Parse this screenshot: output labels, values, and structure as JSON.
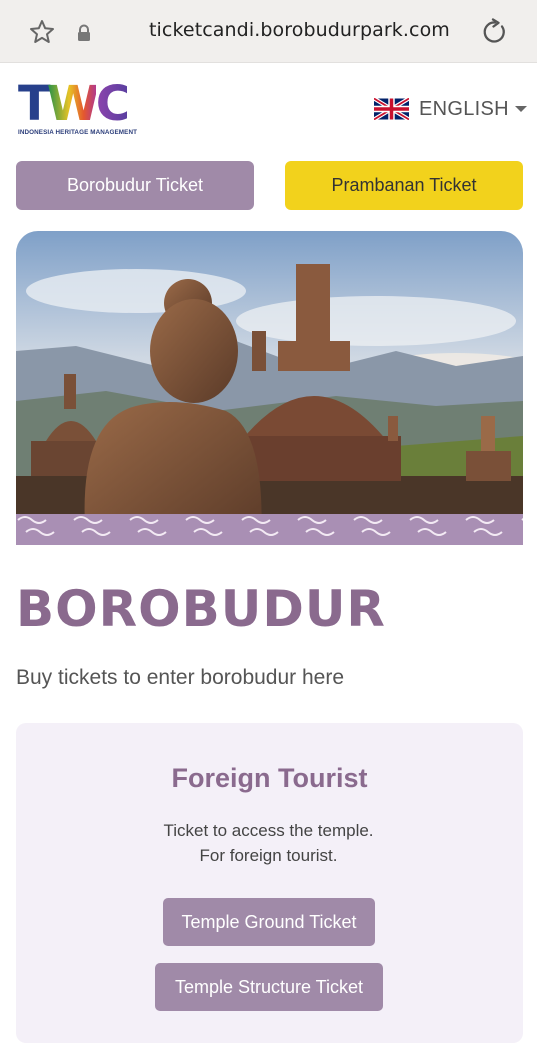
{
  "browser": {
    "url": "ticketcandi.borobudurpark.com",
    "icons": [
      "star-icon",
      "lock-icon",
      "reload-icon"
    ]
  },
  "header": {
    "logo_letters": [
      "T",
      "W",
      "C"
    ],
    "logo_subtitle": "INDONESIA HERITAGE MANAGEMENT",
    "language_label": "ENGLISH",
    "flag_icon": "uk-flag-icon"
  },
  "tabs": [
    {
      "label": "Borobudur Ticket",
      "color": "#a08aa8"
    },
    {
      "label": "Prambanan Ticket",
      "color": "#f2d21c"
    }
  ],
  "main": {
    "title": "BOROBUDUR",
    "subtitle": "Buy tickets to enter borobudur here"
  },
  "card": {
    "title": "Foreign Tourist",
    "description_lines": [
      "Ticket to access the temple.",
      "For foreign tourist."
    ],
    "buttons": [
      "Temple Ground Ticket",
      "Temple Structure Ticket"
    ]
  },
  "colors": {
    "accent_purple": "#8a6a8e",
    "button_purple": "#a08aa8",
    "accent_yellow": "#f2d21c",
    "card_bg": "#f4f0f8"
  }
}
